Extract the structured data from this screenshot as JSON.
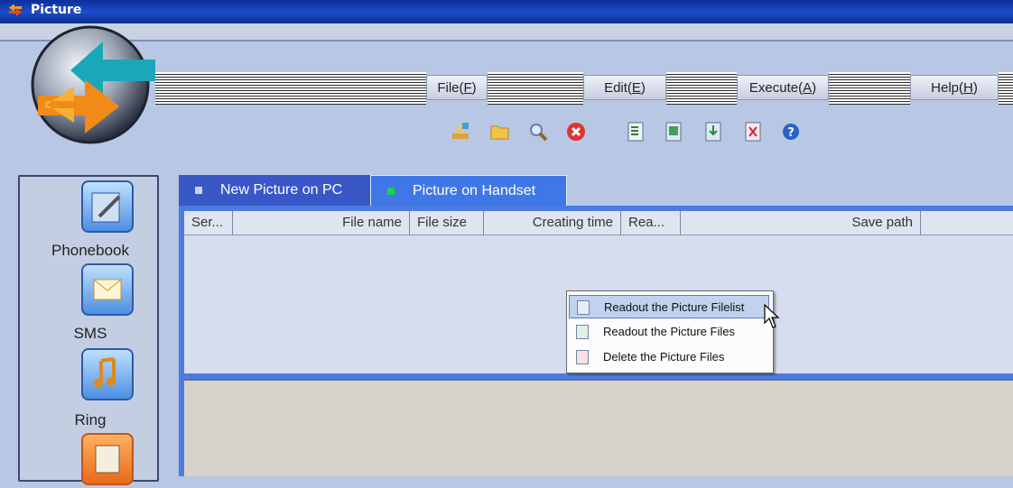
{
  "window": {
    "title": "Picture"
  },
  "menubar": {
    "file": {
      "prefix": "File(",
      "key": "F",
      "suffix": ")"
    },
    "edit": {
      "prefix": "Edit(",
      "key": "E",
      "suffix": ")"
    },
    "execute": {
      "prefix": "Execute(",
      "key": "A",
      "suffix": ")"
    },
    "help": {
      "prefix": "Help(",
      "key": "H",
      "suffix": ")"
    }
  },
  "toolbar": {
    "icons": [
      "new-user-icon",
      "open-folder-icon",
      "search-icon",
      "delete-icon",
      "readout-filelist-icon",
      "readout-files-icon",
      "download-icon",
      "delete-files-icon",
      "help-icon"
    ]
  },
  "sidebar": {
    "items": [
      {
        "label": "Phonebook",
        "icon": "phonebook-icon"
      },
      {
        "label": "SMS",
        "icon": "sms-icon"
      },
      {
        "label": "Ring",
        "icon": "ring-icon"
      },
      {
        "label": "",
        "icon": "picture-icon",
        "active": true
      }
    ]
  },
  "tabs": [
    {
      "label": "New Picture on PC",
      "active": false,
      "indicator_color": "#c8d4f2"
    },
    {
      "label": "Picture on Handset",
      "active": true,
      "indicator_color": "#17d24a"
    }
  ],
  "table": {
    "columns": [
      "Ser...",
      "File name",
      "File size",
      "Creating time",
      "Rea...",
      "Save path"
    ],
    "rows": []
  },
  "context_menu": {
    "items": [
      {
        "label": "Readout the Picture Filelist",
        "highlighted": true
      },
      {
        "label": "Readout the Picture Files",
        "highlighted": false
      },
      {
        "label": "Delete the Picture Files",
        "highlighted": false
      }
    ]
  },
  "colors": {
    "titlebar": "#1e4cc9",
    "background": "#b7c7e4",
    "tab_active": "#3f78e6",
    "tab_inactive": "#3a57c8",
    "list_frame": "#4d7be0"
  }
}
